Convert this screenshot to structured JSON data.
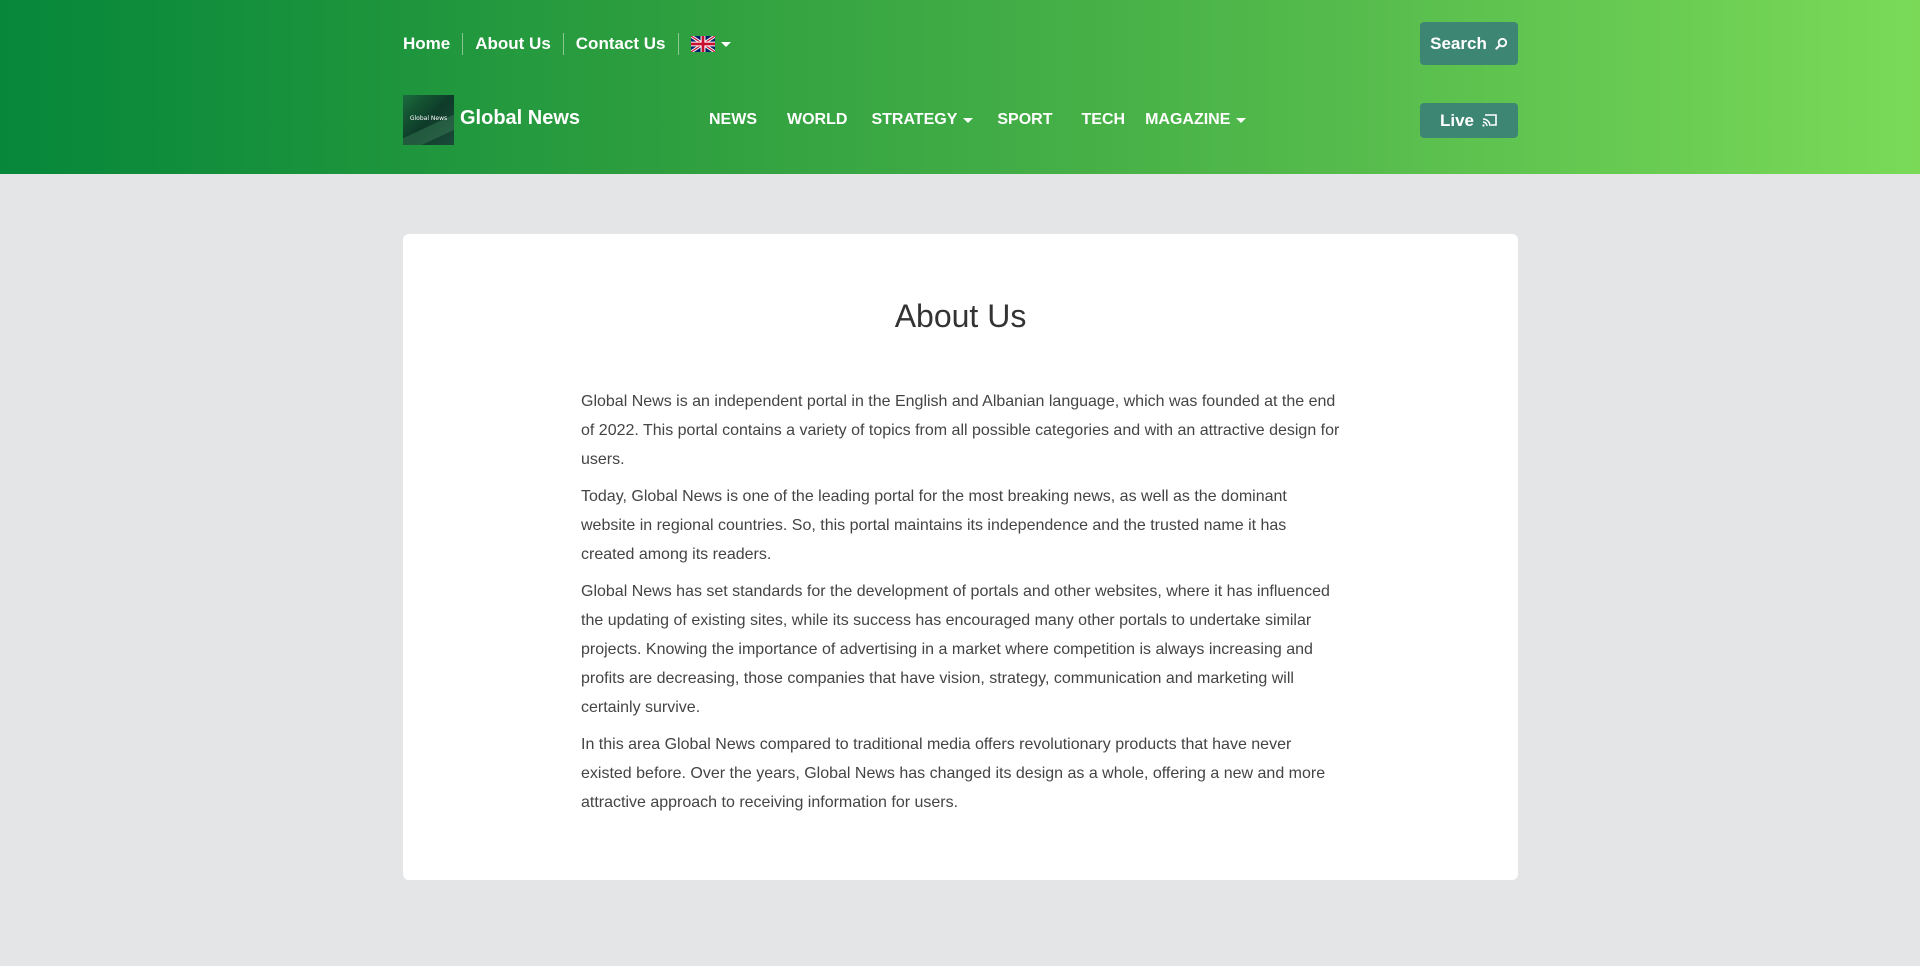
{
  "topnav": {
    "items": [
      "Home",
      "About Us",
      "Contact Us"
    ],
    "language": "English"
  },
  "search_label": "Search",
  "brand": {
    "name": "Global News",
    "logo_text": "Global News"
  },
  "mainnav": {
    "items": [
      "NEWS",
      "WORLD",
      "STRATEGY",
      "SPORT",
      "TECH",
      "MAGAZINE"
    ]
  },
  "live_label": "Live",
  "page": {
    "title": "About Us",
    "paragraphs": [
      "Global News is an independent portal in the English and Albanian language, which was founded at the end of 2022. This portal contains a variety of topics from all possible categories and with an attractive design for users.",
      "Today, Global News is one of the leading portal for the most breaking news, as well as the dominant website in regional countries. So, this portal maintains its independence and the trusted name it has created among its readers.",
      "Global News has set standards for the development of portals and other websites, where it has influenced the updating of existing sites, while its success has encouraged many other portals to undertake similar projects. Knowing the importance of advertising in a market where competition is always increasing and profits are decreasing, those companies that have vision, strategy, communication and marketing will certainly survive.",
      "In this area Global News compared to traditional media offers revolutionary products that have never existed before. Over the years, Global News has changed its design as a whole, offering a new and more attractive approach to receiving information for users."
    ]
  },
  "colors": {
    "header_gradient_start": "#06873a",
    "header_gradient_end": "#7ada58",
    "button_bg": "#3d8674",
    "page_bg": "#e4e5e7"
  },
  "icons": [
    "uk-flag-icon",
    "search-icon",
    "cast-icon",
    "caret-down-icon"
  ]
}
